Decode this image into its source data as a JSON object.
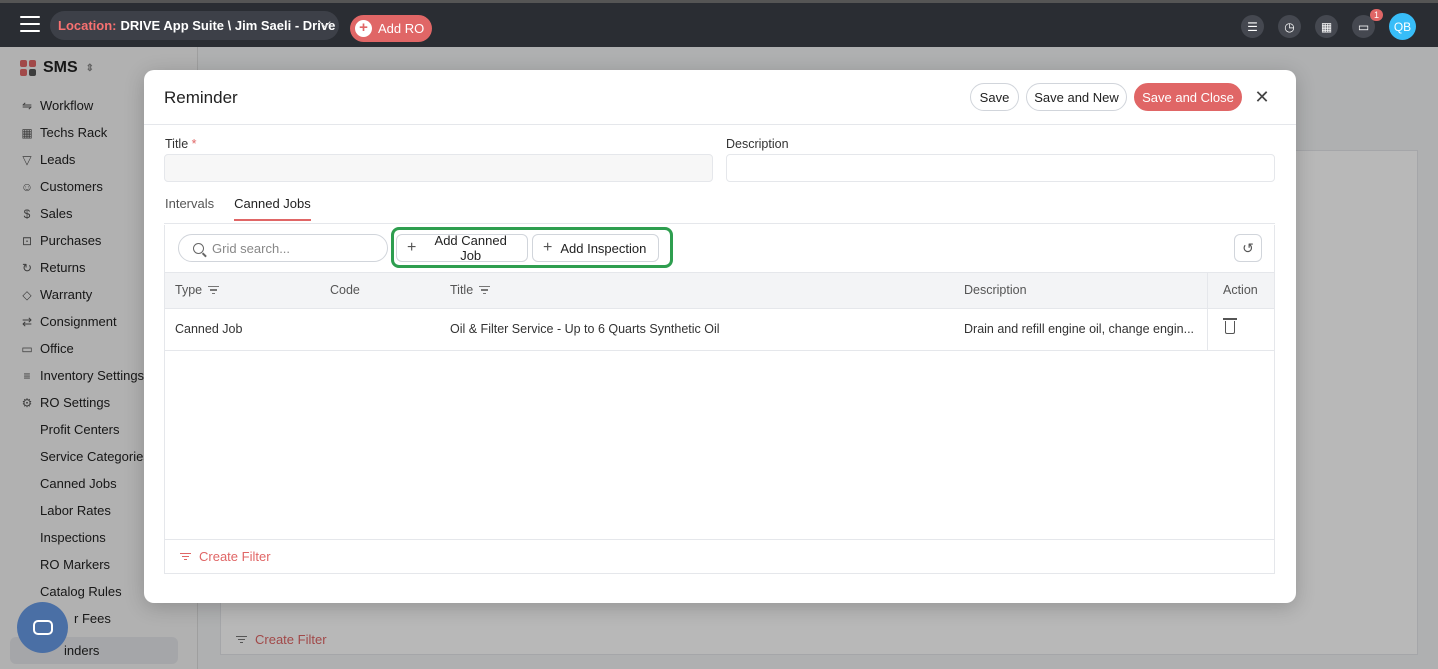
{
  "topbar": {
    "location_label": "Location:",
    "location_value": "DRIVE App Suite \\ Jim Saeli - Drive",
    "add_ro": "Add RO",
    "notification_count": "1",
    "avatar_initials": "QB"
  },
  "sidebar": {
    "brand": "SMS",
    "items": [
      {
        "label": "Workflow",
        "icon": "workflow-icon"
      },
      {
        "label": "Techs Rack",
        "icon": "grid-icon"
      },
      {
        "label": "Leads",
        "icon": "funnel-icon"
      },
      {
        "label": "Customers",
        "icon": "users-icon"
      },
      {
        "label": "Sales",
        "icon": "dollar-icon"
      },
      {
        "label": "Purchases",
        "icon": "cart-icon"
      },
      {
        "label": "Returns",
        "icon": "return-icon"
      },
      {
        "label": "Warranty",
        "icon": "shield-icon"
      },
      {
        "label": "Consignment",
        "icon": "swap-icon"
      },
      {
        "label": "Office",
        "icon": "briefcase-icon"
      },
      {
        "label": "Inventory Settings",
        "icon": "list-icon"
      },
      {
        "label": "RO Settings",
        "icon": "gears-icon"
      }
    ],
    "sub_items": [
      "Profit Centers",
      "Service Categories",
      "Canned Jobs",
      "Labor Rates",
      "Inspections",
      "RO Markers",
      "Catalog Rules",
      "r Fees",
      "inders"
    ]
  },
  "background": {
    "create_filter": "Create Filter",
    "header_action": "Action"
  },
  "modal": {
    "title": "Reminder",
    "save": "Save",
    "save_and_new": "Save and New",
    "save_and_close": "Save and Close",
    "fields": {
      "title_label": "Title",
      "title_required": "*",
      "title_value": "",
      "description_label": "Description",
      "description_value": ""
    },
    "tabs": [
      "Intervals",
      "Canned Jobs"
    ],
    "active_tab": "Canned Jobs",
    "grid": {
      "search_placeholder": "Grid search...",
      "add_canned_job": "Add Canned Job",
      "add_inspection": "Add Inspection",
      "columns": [
        "Type",
        "Code",
        "Title",
        "Description",
        "Action"
      ],
      "rows": [
        {
          "type": "Canned Job",
          "code": "",
          "title": "Oil & Filter Service - Up to 6 Quarts Synthetic Oil",
          "description": "Drain and refill engine oil, change engin..."
        }
      ],
      "create_filter": "Create Filter"
    }
  },
  "colors": {
    "accent": "#e06666",
    "highlight": "#2e9e4f",
    "topbar": "#2a2d33"
  }
}
